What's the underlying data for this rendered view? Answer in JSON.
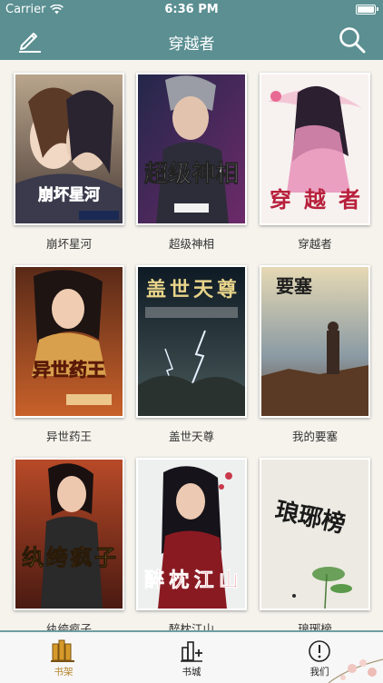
{
  "status_bar": {
    "carrier": "Carrier",
    "time": "6:36 PM"
  },
  "nav": {
    "title": "穿越者",
    "left_icon": "edit-icon",
    "right_icon": "search-icon"
  },
  "colors": {
    "nav_bg": "#5b8f92",
    "active_tab": "#b6862f",
    "page_bg": "#f5f3ec"
  },
  "books": [
    {
      "title": "崩坏星河",
      "cover_text": "崩坏星河"
    },
    {
      "title": "超级神相",
      "cover_text": "超级神相"
    },
    {
      "title": "穿越者",
      "cover_text": "穿越者"
    },
    {
      "title": "异世药王",
      "cover_text": "异世药王"
    },
    {
      "title": "盖世天尊",
      "cover_text": "盖世天尊"
    },
    {
      "title": "我的要塞",
      "cover_text": "要塞"
    },
    {
      "title": "纨绔疯子",
      "cover_text": "纨绔疯子"
    },
    {
      "title": "醉枕江山",
      "cover_text": "醉枕江山"
    },
    {
      "title": "琅琊榜",
      "cover_text": "琅琊榜"
    }
  ],
  "tabs": [
    {
      "label": "书架",
      "icon": "bookshelf-icon",
      "active": true
    },
    {
      "label": "书城",
      "icon": "bookstore-icon",
      "active": false
    },
    {
      "label": "我们",
      "icon": "info-icon",
      "active": false
    }
  ]
}
